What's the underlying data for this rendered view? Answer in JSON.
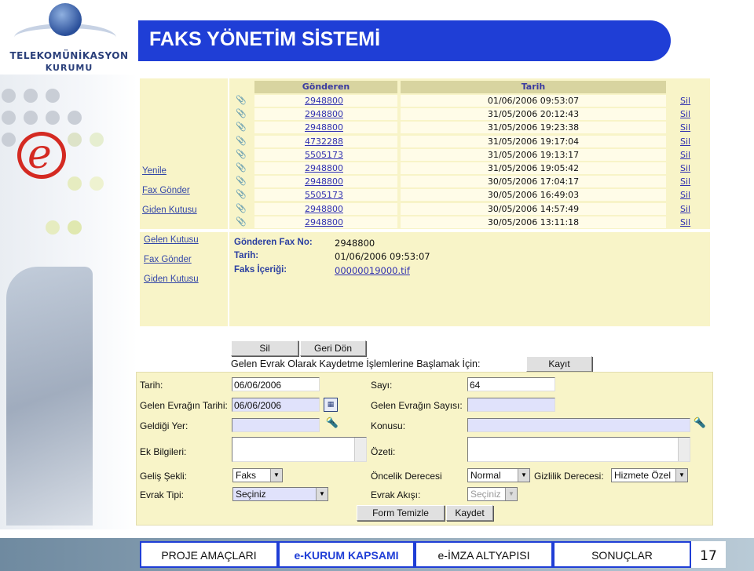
{
  "logo": {
    "line1": "TELEKOMÜNİKASYON",
    "line2": "KURUMU"
  },
  "title": "FAKS YÖNETİM SİSTEMİ",
  "nav1": [
    "Yenile",
    "Fax Gönder",
    "Giden Kutusu"
  ],
  "nav2": [
    "Gelen Kutusu",
    "Fax Gönder",
    "Giden Kutusu"
  ],
  "inbox": {
    "col_sender": "Gönderen",
    "col_date": "Tarih",
    "delete_label": "Sil",
    "rows": [
      {
        "sender": "2948800",
        "date": "01/06/2006 09:53:07"
      },
      {
        "sender": "2948800",
        "date": "31/05/2006 20:12:43"
      },
      {
        "sender": "2948800",
        "date": "31/05/2006 19:23:38"
      },
      {
        "sender": "4732288",
        "date": "31/05/2006 19:17:04"
      },
      {
        "sender": "5505173",
        "date": "31/05/2006 19:13:17"
      },
      {
        "sender": "2948800",
        "date": "31/05/2006 19:05:42"
      },
      {
        "sender": "2948800",
        "date": "30/05/2006 17:04:17"
      },
      {
        "sender": "5505173",
        "date": "30/05/2006 16:49:03"
      },
      {
        "sender": "2948800",
        "date": "30/05/2006 14:57:49"
      },
      {
        "sender": "2948800",
        "date": "30/05/2006 13:11:18"
      }
    ]
  },
  "detail": {
    "sender_label": "Gönderen Fax No:",
    "sender_value": "2948800",
    "date_label": "Tarih:",
    "date_value": "01/06/2006 09:53:07",
    "content_label": "Faks İçeriği:",
    "content_value": "00000019000.tif"
  },
  "actions": {
    "delete": "Sil",
    "back": "Geri Dön",
    "register_text": "Gelen Evrak Olarak Kaydetme İşlemlerine Başlamak İçin:",
    "register": "Kayıt"
  },
  "form": {
    "date_label": "Tarih:",
    "date_value": "06/06/2006",
    "number_label": "Sayı:",
    "number_value": "64",
    "incoming_date_label": "Gelen Evrağın Tarihi:",
    "incoming_date_value": "06/06/2006",
    "incoming_number_label": "Gelen Evrağın Sayısı:",
    "incoming_number_value": "",
    "origin_label": "Geldiği Yer:",
    "origin_value": "",
    "subject_label": "Konusu:",
    "subject_value": "",
    "extra_label": "Ek Bilgileri:",
    "summary_label": "Özeti:",
    "arrival_label": "Geliş Şekli:",
    "arrival_value": "Faks",
    "priority_label": "Öncelik Derecesi",
    "priority_value": "Normal",
    "privacy_label": "Gizlilik Derecesi:",
    "privacy_value": "Hizmete Özel",
    "doctype_label": "Evrak Tipi:",
    "doctype_value": "Seçiniz",
    "flow_label": "Evrak Akışı:",
    "flow_value": "Seçiniz",
    "clear": "Form Temizle",
    "save": "Kaydet"
  },
  "footer": {
    "tabs": [
      "PROJE AMAÇLARI",
      "e-KURUM KAPSAMI",
      "e-İMZA ALTYAPISI",
      "SONUÇLAR"
    ],
    "active_color": "#1f3ed6",
    "page": "17"
  }
}
